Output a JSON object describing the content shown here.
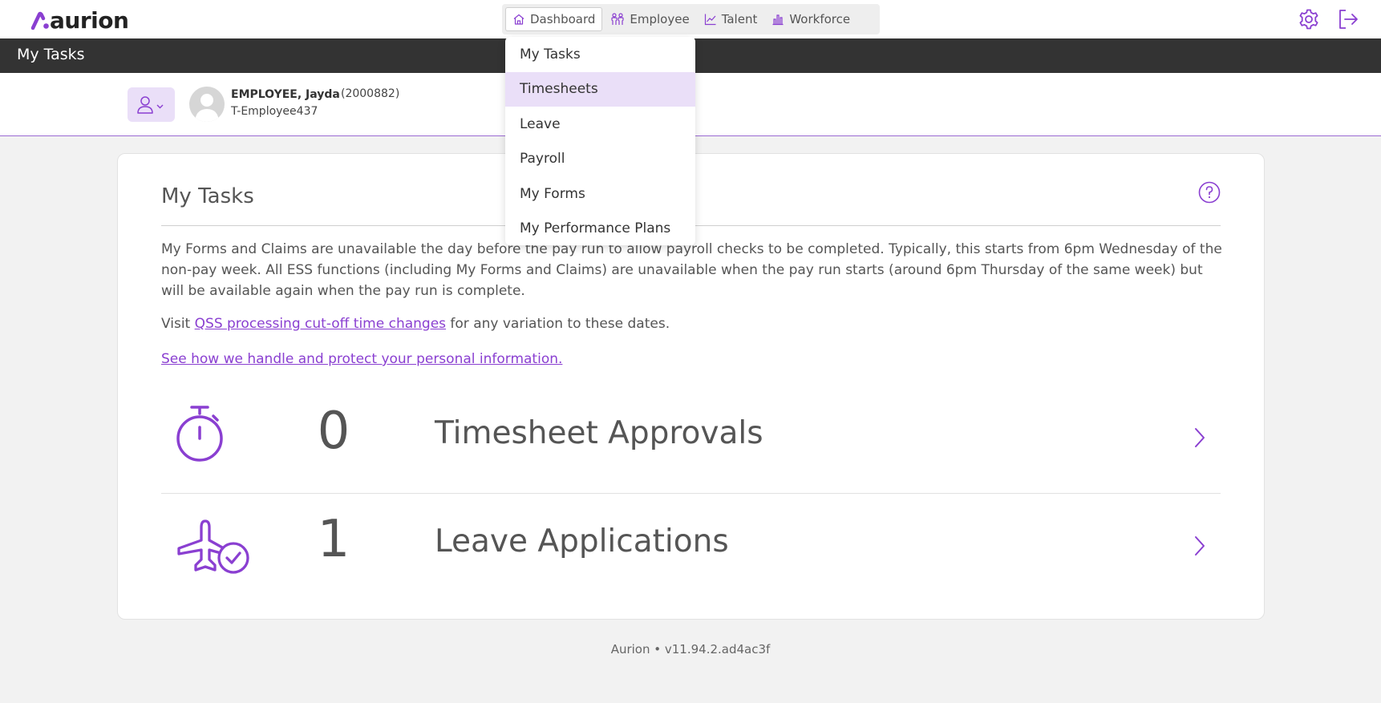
{
  "app": {
    "logo_text": "aurion",
    "brand_color": "#8a3fd1"
  },
  "nav": [
    {
      "label": "Dashboard",
      "icon": "home-icon"
    },
    {
      "label": "Employee",
      "icon": "people-icon"
    },
    {
      "label": "Talent",
      "icon": "trend-icon"
    },
    {
      "label": "Workforce",
      "icon": "bars-icon"
    }
  ],
  "header_icons": {
    "settings": "gear-icon",
    "logout": "logout-icon"
  },
  "dropdown": {
    "items": [
      "My Tasks",
      "Timesheets",
      "Leave",
      "Payroll",
      "My Forms",
      "My Performance Plans"
    ],
    "selected": "Timesheets"
  },
  "page": {
    "title": "My Tasks"
  },
  "employee": {
    "name": "EMPLOYEE, Jayda",
    "id": "(2000882)",
    "code": "T-Employee437"
  },
  "card": {
    "title": "My Tasks",
    "notice": "My Forms and Claims are unavailable the day before the pay run to allow payroll checks to be completed. Typically, this starts from 6pm Wednesday of the non-pay week. All ESS functions (including My Forms and Claims) are unavailable when the pay run starts (around 6pm Thursday of the same week) but will be available again when the pay run is complete.",
    "visit_prefix": "Visit ",
    "visit_link": "QSS processing cut-off time changes",
    "visit_suffix": " for any variation to these dates.",
    "privacy_link": "See how we handle and protect your personal information."
  },
  "tasks": [
    {
      "count": "0",
      "label": "Timesheet Approvals",
      "icon": "stopwatch-icon"
    },
    {
      "count": "1",
      "label": "Leave Applications",
      "icon": "plane-check-icon"
    }
  ],
  "footer": {
    "version": "Aurion • v11.94.2.ad4ac3f"
  }
}
